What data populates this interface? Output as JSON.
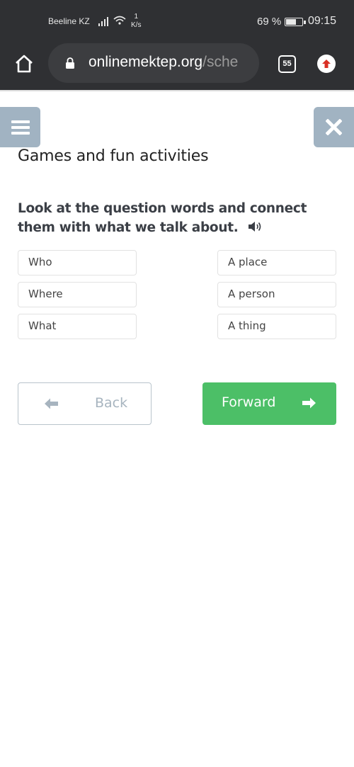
{
  "status_bar": {
    "carrier": "Beeline KZ",
    "speed_value": "1",
    "speed_unit": "K/s",
    "battery_percent": "69 %",
    "battery_level": 0.69,
    "time": "09:15"
  },
  "browser": {
    "url_domain": "onlinemektep.org",
    "url_path": "/sche",
    "tab_count": "55"
  },
  "page": {
    "title": "Games and fun activities",
    "question": "Look at the question words and connect them with what we talk about.",
    "left_items": [
      "Who",
      "Where",
      "What"
    ],
    "right_items": [
      "A place",
      "A person",
      "A thing"
    ],
    "back_label": "Back",
    "forward_label": "Forward"
  },
  "colors": {
    "forward_green": "#4cbf67",
    "side_button": "#a1b3c2",
    "browser_dark": "#2f3033"
  }
}
